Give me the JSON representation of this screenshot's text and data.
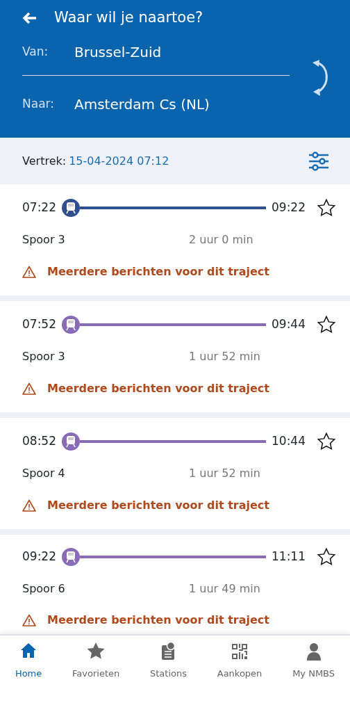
{
  "header": {
    "title": "Waar wil je naartoe?",
    "from_label": "Van:",
    "from": "Brussel-Zuid",
    "to_label": "Naar:",
    "to": "Amsterdam Cs (NL)"
  },
  "departure": {
    "label": "Vertrek:",
    "value": "15-04-2024 07:12"
  },
  "trips": [
    {
      "depart": "07:22",
      "arrive": "09:22",
      "color": "#2f4f8f",
      "favorite": false,
      "platform": "Spoor 3",
      "duration": "2 uur 0 min",
      "notice": "Meerdere berichten voor dit traject"
    },
    {
      "depart": "07:52",
      "arrive": "09:44",
      "color": "#8a6bb8",
      "favorite": false,
      "platform": "Spoor 3",
      "duration": "1 uur 52 min",
      "notice": "Meerdere berichten voor dit traject"
    },
    {
      "depart": "08:52",
      "arrive": "10:44",
      "color": "#8a6bb8",
      "favorite": false,
      "platform": "Spoor 4",
      "duration": "1 uur 52 min",
      "notice": "Meerdere berichten voor dit traject"
    },
    {
      "depart": "09:22",
      "arrive": "11:11",
      "color": "#8a6bb8",
      "favorite": false,
      "platform": "Spoor 6",
      "duration": "1 uur 49 min",
      "notice": "Meerdere berichten voor dit traject"
    }
  ],
  "tabs": [
    {
      "kind": "home",
      "label": "Home",
      "selected": true
    },
    {
      "kind": "star",
      "label": "Favorieten",
      "selected": false
    },
    {
      "kind": "stations",
      "label": "Stations",
      "selected": false
    },
    {
      "kind": "qr",
      "label": "Aankopen",
      "selected": false
    },
    {
      "kind": "person",
      "label": "My NMBS",
      "selected": false
    }
  ]
}
